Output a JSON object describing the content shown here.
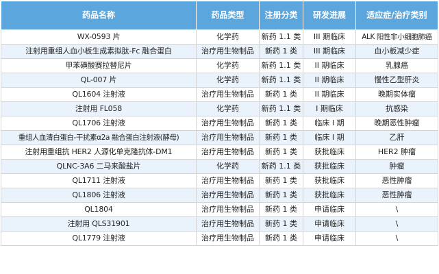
{
  "colors": {
    "header_bg": "#5ba7dd",
    "row_alt": "#eaf3fb",
    "border": "#d4d4d4"
  },
  "headers": [
    "药品名称",
    "药品类型",
    "注册分类",
    "研发进展",
    "适应症/治疗类别"
  ],
  "rows": [
    [
      "WX-0593 片",
      "化学药",
      "新药 1.1 类",
      "III 期临床",
      "ALK 阳性非小细胞肺癌"
    ],
    [
      "注射用重组人血小板生成素拟肽-Fc 融合蛋白",
      "治疗用生物制品",
      "新药 1 类",
      "III 期临床",
      "血小板减少症"
    ],
    [
      "甲苯磺酸赛拉替尼片",
      "化学药",
      "新药 1.1 类",
      "II 期临床",
      "乳腺癌"
    ],
    [
      "QL-007 片",
      "化学药",
      "新药 1.1 类",
      "II 期临床",
      "慢性乙型肝炎"
    ],
    [
      "QL1604 注射液",
      "治疗用生物制品",
      "新药 1 类",
      "II 期临床",
      "晚期实体瘤"
    ],
    [
      "注射用 FL058",
      "化学药",
      "新药 1.1 类",
      "I 期临床",
      "抗感染"
    ],
    [
      "QL1706 注射液",
      "治疗用生物制品",
      "新药 1 类",
      "临床 I 期",
      "晚期恶性肿瘤"
    ],
    [
      "重组人血清白蛋白-干扰素α2a 融合蛋白注射液(酵母)",
      "治疗用生物制品",
      "新药 1 类",
      "临床 I 期",
      "乙肝"
    ],
    [
      "注射用重组抗 HER2 人源化单克隆抗体-DM1",
      "治疗用生物制品",
      "新药 1 类",
      "获批临床",
      "HER2 肿瘤"
    ],
    [
      "QLNC-3A6 二马来酸盐片",
      "化学药",
      "新药 1.1 类",
      "获批临床",
      "肿瘤"
    ],
    [
      "QL1711 注射液",
      "治疗用生物制品",
      "新药 1 类",
      "获批临床",
      "恶性肿瘤"
    ],
    [
      "QL1806 注射液",
      "治疗用生物制品",
      "新药 1 类",
      "获批临床",
      "恶性肿瘤"
    ],
    [
      "QL1804",
      "治疗用生物制品",
      "新药 1 类",
      "申请临床",
      "\\"
    ],
    [
      "注射用 QLS31901",
      "治疗用生物制品",
      "新药 1 类",
      "申请临床",
      "\\"
    ],
    [
      "QL1779 注射液",
      "治疗用生物制品",
      "新药 1 类",
      "申请临床",
      "\\"
    ]
  ]
}
